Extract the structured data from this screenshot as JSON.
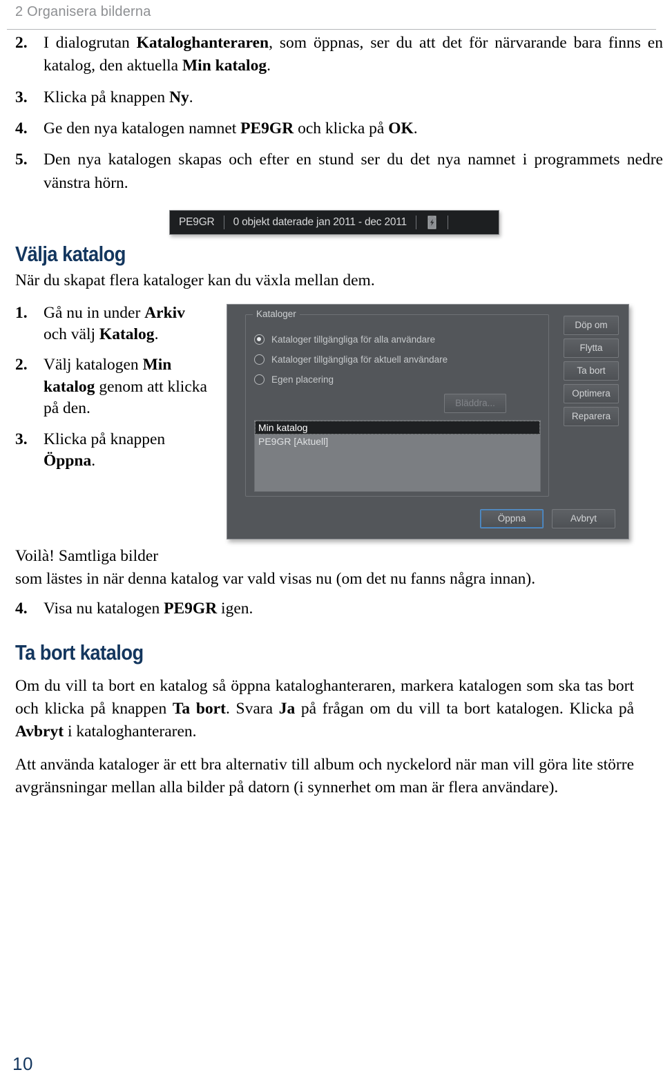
{
  "header": {
    "running_head": "2 Organisera bilderna"
  },
  "folio": "10",
  "steps_top": [
    {
      "num": "2.",
      "parts": [
        {
          "t": "I dialogrutan ",
          "b": false
        },
        {
          "t": "Kataloghanteraren",
          "b": true
        },
        {
          "t": ", som öppnas, ser du att det för närvarande bara finns en katalog, den aktuella ",
          "b": false
        },
        {
          "t": "Min katalog",
          "b": true
        },
        {
          "t": ".",
          "b": false
        }
      ]
    },
    {
      "num": "3.",
      "parts": [
        {
          "t": "Klicka på knappen ",
          "b": false
        },
        {
          "t": "Ny",
          "b": true
        },
        {
          "t": ".",
          "b": false
        }
      ]
    },
    {
      "num": "4.",
      "parts": [
        {
          "t": "Ge den nya katalogen namnet ",
          "b": false
        },
        {
          "t": "PE9GR",
          "b": true
        },
        {
          "t": " och klicka på ",
          "b": false
        },
        {
          "t": "OK",
          "b": true
        },
        {
          "t": ".",
          "b": false
        }
      ]
    },
    {
      "num": "5.",
      "parts": [
        {
          "t": "Den nya katalogen skapas och efter en stund ser du det nya namnet i programmets nedre vänstra hörn.",
          "b": false
        }
      ]
    }
  ],
  "statusbar": {
    "catalog_name": "PE9GR",
    "info": "0 objekt daterade jan 2011 - dec 2011",
    "icon": "smart-tag-icon"
  },
  "section_valja": {
    "title": "Välja katalog",
    "intro": "När du skapat flera kataloger kan du växla mellan dem."
  },
  "steps_valja": [
    {
      "num": "1.",
      "parts": [
        {
          "t": "Gå nu in under ",
          "b": false
        },
        {
          "t": "Arkiv",
          "b": true
        },
        {
          "t": " och välj ",
          "b": false
        },
        {
          "t": "Katalog",
          "b": true
        },
        {
          "t": ".",
          "b": false
        }
      ]
    },
    {
      "num": "2.",
      "parts": [
        {
          "t": "Välj katalogen ",
          "b": false
        },
        {
          "t": "Min katalog",
          "b": true
        },
        {
          "t": " genom att klicka på den.",
          "b": false
        }
      ]
    },
    {
      "num": "3.",
      "parts": [
        {
          "t": "Klicka på knappen ",
          "b": false
        },
        {
          "t": "Öppna",
          "b": true
        },
        {
          "t": ".",
          "b": false
        }
      ]
    }
  ],
  "dialog": {
    "groupbox_title": "Kataloger",
    "radios": [
      {
        "label": "Kataloger tillgängliga för alla användare",
        "checked": true
      },
      {
        "label": "Kataloger tillgängliga för aktuell användare",
        "checked": false
      },
      {
        "label": "Egen placering",
        "checked": false
      }
    ],
    "browse_button": "Bläddra...",
    "side_buttons": [
      "Döp om",
      "Flytta",
      "Ta bort",
      "Optimera",
      "Reparera"
    ],
    "list_items": [
      {
        "label": "Min katalog",
        "selected": true
      },
      {
        "label": "PE9GR [Aktuell]",
        "selected": false
      }
    ],
    "open_button": "Öppna",
    "cancel_button": "Avbryt"
  },
  "voila": {
    "line1": "Voilà! Samtliga bilder",
    "line2": "som lästes in när denna katalog var vald visas nu (om det nu fanns några innan)."
  },
  "steps_after": [
    {
      "num": "4.",
      "parts": [
        {
          "t": "Visa nu katalogen ",
          "b": false
        },
        {
          "t": "PE9GR",
          "b": true
        },
        {
          "t": " igen.",
          "b": false
        }
      ]
    }
  ],
  "section_tabort": {
    "title": "Ta bort katalog",
    "paragraph1": [
      {
        "t": "Om du vill ta bort en katalog så öppna kataloghanteraren, markera katalogen som ska tas bort och klicka på knappen ",
        "b": false
      },
      {
        "t": "Ta bort",
        "b": true
      },
      {
        "t": ". Svara ",
        "b": false
      },
      {
        "t": "Ja",
        "b": true
      },
      {
        "t": " på frågan om du vill ta bort katalogen. Klicka på ",
        "b": false
      },
      {
        "t": "Avbryt",
        "b": true
      },
      {
        "t": " i kataloghanteraren.",
        "b": false
      }
    ],
    "paragraph2": [
      {
        "t": "Att använda kataloger är ett bra alternativ till album och nyckelord när man vill göra lite större avgränsningar mellan alla bilder på datorn (i synnerhet om man är flera användare).",
        "b": false
      }
    ]
  },
  "colors": {
    "heading_blue": "#13365e",
    "running_head_gray": "#8d8f92",
    "dialog_bg": "#53565a",
    "statusbar_bg": "#1d1f21",
    "list_bg": "#7b7e82"
  }
}
